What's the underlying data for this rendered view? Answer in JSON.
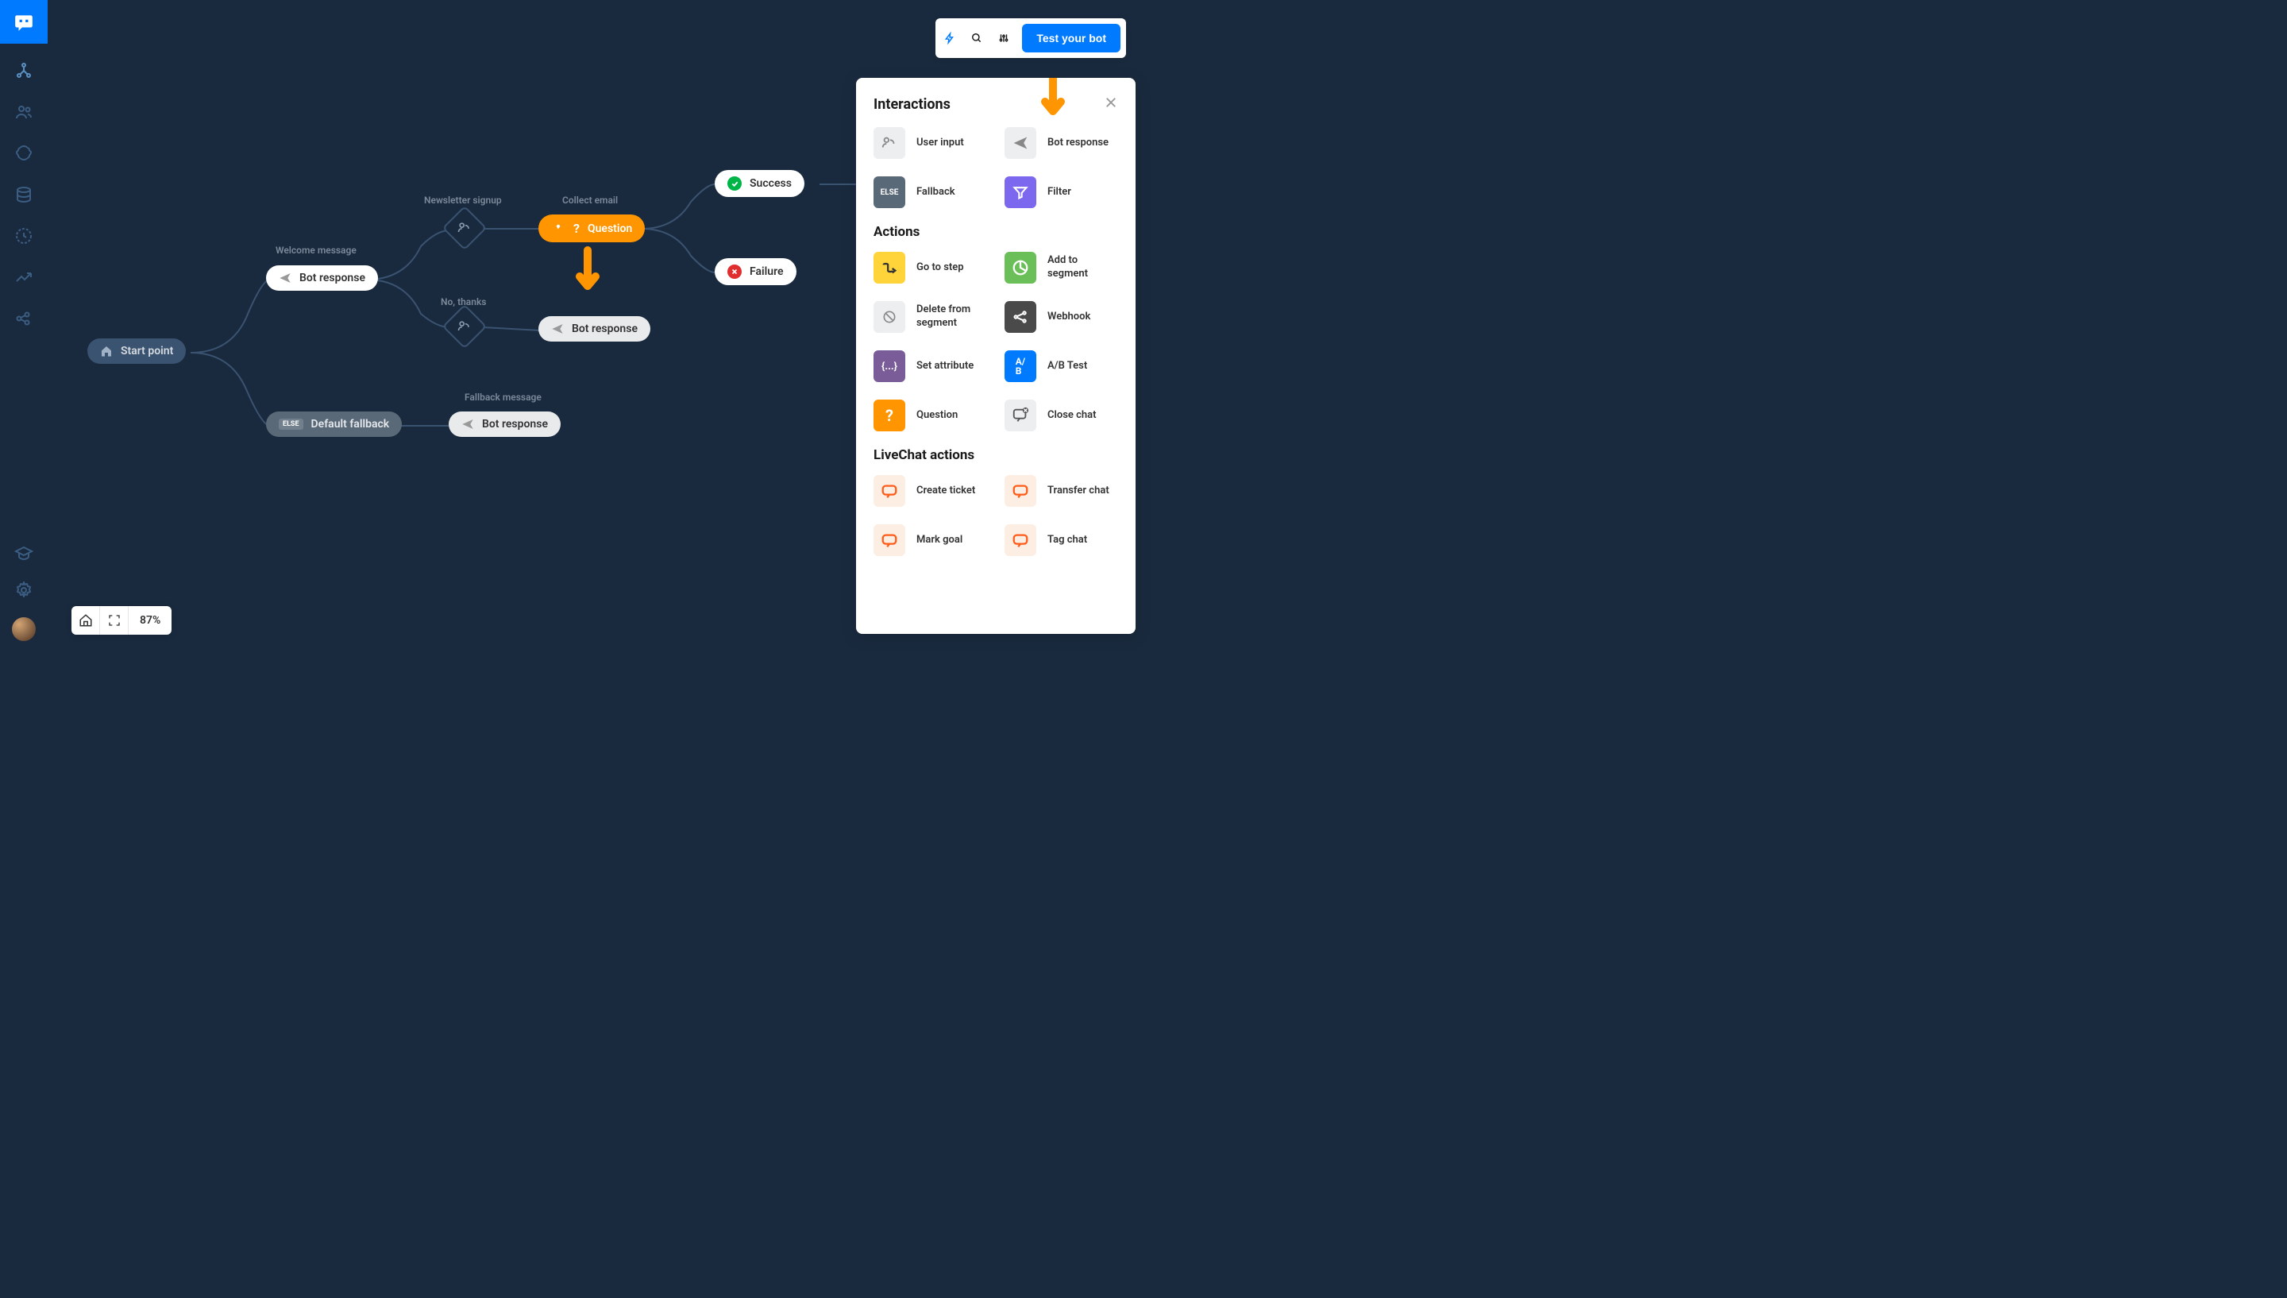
{
  "topbar": {
    "test_button": "Test your bot"
  },
  "zoom": {
    "value": "87%"
  },
  "canvas": {
    "start_point": "Start point",
    "welcome_label": "Welcome message",
    "bot_response_1": "Bot response",
    "newsletter_label": "Newsletter signup",
    "no_thanks_label": "No, thanks",
    "collect_email_label": "Collect email",
    "question_node": "Question",
    "bot_response_2": "Bot response",
    "success_node": "Success",
    "failure_node": "Failure",
    "fallback_label": "Fallback message",
    "default_fallback": "Default fallback",
    "bot_response_3": "Bot response",
    "else_badge": "ELSE"
  },
  "panel": {
    "section_interactions": "Interactions",
    "section_actions": "Actions",
    "section_livechat": "LiveChat actions",
    "items": {
      "user_input": "User input",
      "bot_response": "Bot response",
      "fallback": "Fallback",
      "filter": "Filter",
      "go_to_step": "Go to step",
      "add_to_segment": "Add to segment",
      "delete_from_segment": "Delete from segment",
      "webhook": "Webhook",
      "set_attribute": "Set attribute",
      "ab_test": "A/B Test",
      "question": "Question",
      "close_chat": "Close chat",
      "create_ticket": "Create ticket",
      "transfer_chat": "Transfer chat",
      "mark_goal": "Mark goal",
      "tag_chat": "Tag chat"
    },
    "else_badge": "ELSE"
  }
}
